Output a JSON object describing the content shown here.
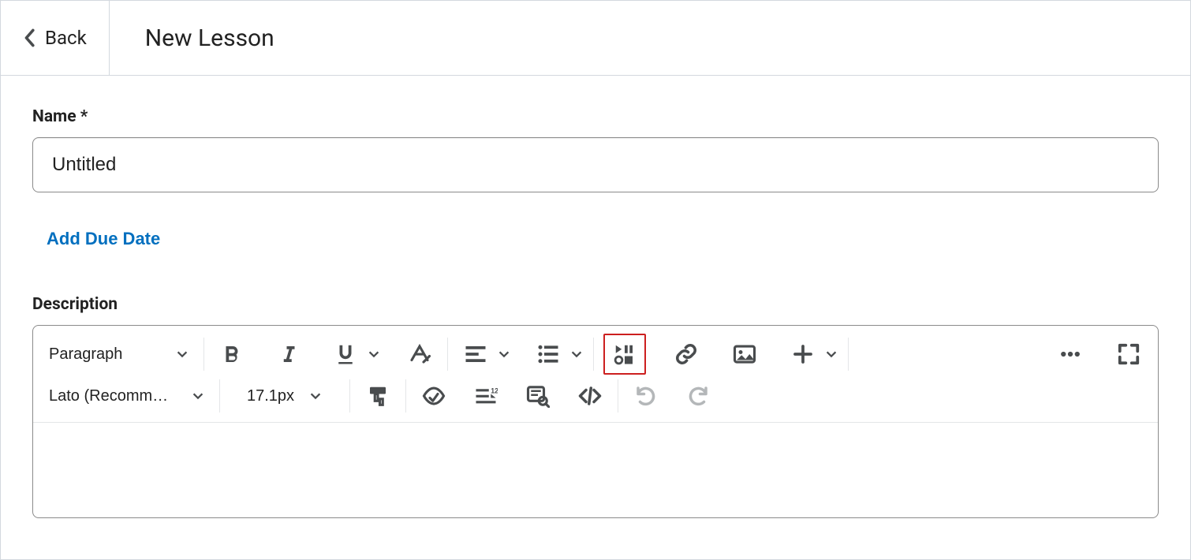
{
  "header": {
    "back_label": "Back",
    "title": "New Lesson"
  },
  "form": {
    "name_label": "Name *",
    "name_value": "Untitled",
    "add_due_date_label": "Add Due Date",
    "description_label": "Description"
  },
  "toolbar": {
    "paragraph_label": "Paragraph",
    "font_label": "Lato (Recomm…",
    "font_size_label": "17.1px",
    "icons": {
      "bold": "bold-icon",
      "italic": "italic-icon",
      "underline": "underline-icon",
      "clear_format": "clear-format-icon",
      "align": "align-icon",
      "list": "list-icon",
      "insert_stuff": "insert-stuff-icon",
      "link": "link-icon",
      "image": "image-icon",
      "plus": "plus-icon",
      "more": "more-icon",
      "fullscreen": "fullscreen-icon",
      "format_painter": "format-painter-icon",
      "accessibility": "accessibility-check-icon",
      "word_count": "word-count-icon",
      "preview": "preview-icon",
      "source_code": "source-code-icon",
      "undo": "undo-icon",
      "redo": "redo-icon"
    }
  }
}
